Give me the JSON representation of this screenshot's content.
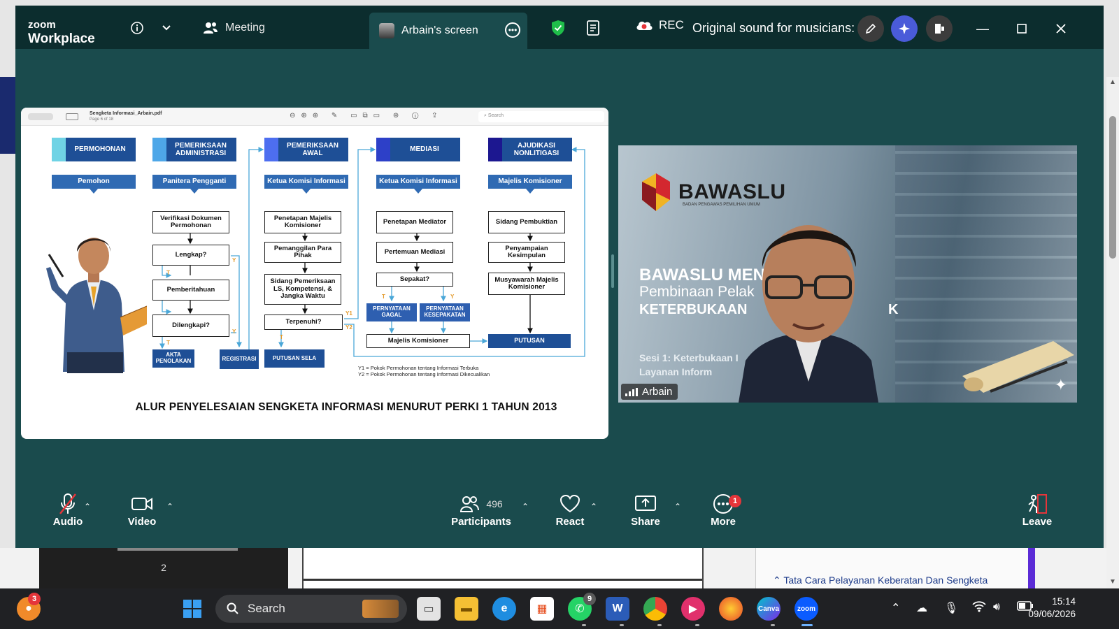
{
  "app": {
    "logo_line1": "zoom",
    "logo_line2": "Workplace",
    "meeting_tab": "Meeting",
    "share_tab": "Arbain's screen",
    "rec_label": "REC",
    "sound_status": "Original sound for musicians: on"
  },
  "colors": {
    "titlebar": "#0c2d2e",
    "stage": "#1a4b4d",
    "shield": "#1fbe4a",
    "ai_button": "#4a5bd9",
    "badge": "#e5353a",
    "col_accent": [
      "#6fd3e5",
      "#4ea7e8",
      "#4d6ef0",
      "#2d40c8",
      "#1c1790"
    ]
  },
  "icons": {
    "info": "info-icon",
    "participants": "participants-icon",
    "shield": "shield-icon",
    "notes": "notes-icon",
    "rec_cloud": "cloud-record-icon",
    "edit": "pencil-icon",
    "ai": "ai-sparkle-icon"
  },
  "pdf": {
    "filename": "Sengketa Informasi_Arbain.pdf",
    "page_info": "Page 6 of 18",
    "search_placeholder": "Search"
  },
  "slide": {
    "columns": [
      {
        "head": "PERMOHONAN",
        "role": "Pemohon"
      },
      {
        "head": "PEMERIKSAAN ADMINISTRASI",
        "role": "Panitera Pengganti"
      },
      {
        "head": "PEMERIKSAAN AWAL",
        "role": "Ketua Komisi Informasi"
      },
      {
        "head": "MEDIASI",
        "role": "Ketua Komisi Informasi"
      },
      {
        "head": "AJUDIKASI NONLITIGASI",
        "role": "Majelis Komisioner"
      }
    ],
    "admin_steps": [
      "Verifikasi Dokumen Permohonan",
      "Lengkap?",
      "Pemberitahuan",
      "Dilengkapi?"
    ],
    "awal_steps": [
      "Penetapan Majelis Komisioner",
      "Pemanggilan Para Pihak",
      "Sidang Pemeriksaan LS, Kompetensi, & Jangka Waktu",
      "Terpenuhi?"
    ],
    "mediasi_steps": [
      "Penetapan Mediator",
      "Pertemuan Mediasi",
      "Sepakat?"
    ],
    "ajudikasi_steps": [
      "Sidang Pembuktian",
      "Penyampaian Kesimpulan",
      "Musyawarah Majelis Komisioner"
    ],
    "results": {
      "akta": "AKTA PENOLAKAN",
      "registrasi": "REGISTRASI",
      "putusan_sela": "PUTUSAN SELA",
      "gagal": "PERNYATAAN GAGAL",
      "kesepakatan": "PERNYATAAN KESEPAKATAN",
      "majelis": "Majelis Komisioner",
      "putusan": "PUTUSAN"
    },
    "labels": {
      "t": "T",
      "y": "Y",
      "y1": "Y1",
      "y2": "Y2"
    },
    "legend_y1": "Y1 = Pokok Permohonan tentang Informasi Terbuka",
    "legend_y2": "Y2 = Pokok Permohonan tentang Informasi Dikecualikan",
    "title": "ALUR PENYELESAIAN SENGKETA INFORMASI  MENURUT PERKI 1 TAHUN 2013"
  },
  "video": {
    "logo_word": "BAWASLU",
    "logo_sub": "BADAN PENGAWAS PEMILIHAN UMUM",
    "line1": "BAWASLU MEN",
    "line2": "Pembinaan Pelak",
    "line3": "KETERBUKAAN",
    "line3b": "K",
    "line4": "Sesi 1: Keterbukaan I",
    "line5": "Layanan Inform",
    "participant_name": "Arbain"
  },
  "controls": {
    "audio": "Audio",
    "video": "Video",
    "participants": "Participants",
    "participants_count": "496",
    "react": "React",
    "share": "Share",
    "more": "More",
    "more_badge": "1",
    "leave": "Leave"
  },
  "background": {
    "thumb_page": "2",
    "panel_heading": "Tata Cara Pelayanan Keberatan Dan Sengketa"
  },
  "taskbar": {
    "search_label": "Search",
    "notif_badge": "3",
    "whatsapp_badge": "9",
    "time": "15:14",
    "date": "09/06/2026"
  }
}
